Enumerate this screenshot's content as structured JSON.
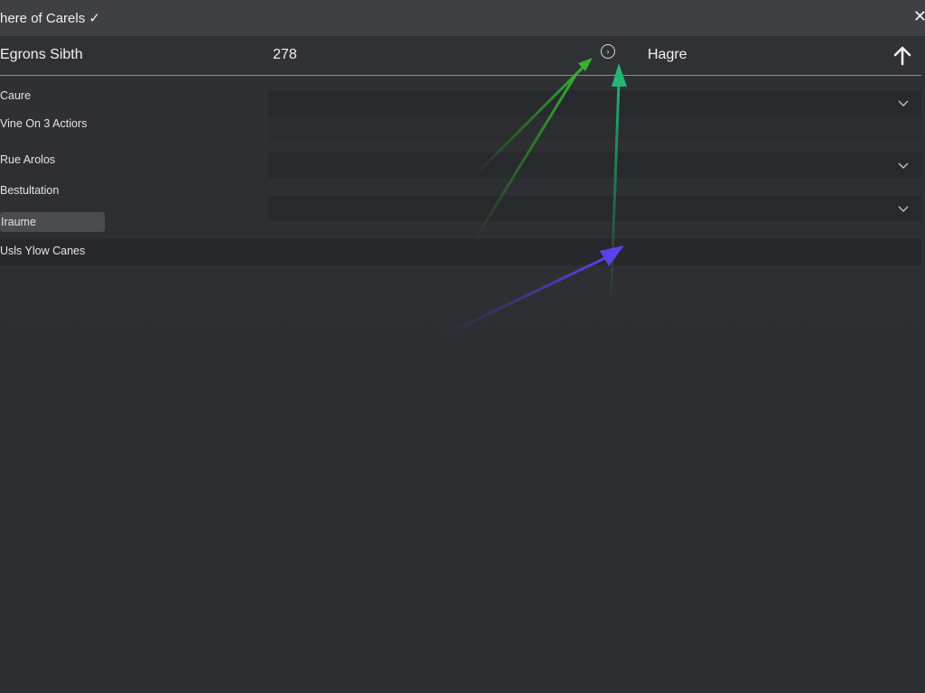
{
  "window": {
    "title": "here of Carels ✓",
    "close_glyph": "✕"
  },
  "header": {
    "name": "Egrons Sibth",
    "count": "278",
    "info_icon": "info-circle-icon",
    "label": "Hagre",
    "up_icon": "arrow-up-icon"
  },
  "sidebar": {
    "items": [
      {
        "label": "Caure"
      },
      {
        "label": "Vine On 3 Actiors"
      },
      {
        "label": "Rue Arolos"
      },
      {
        "label": "Bestultation"
      },
      {
        "label": "Iraume"
      },
      {
        "label": "Usls Ylow Canes"
      }
    ]
  },
  "dropdowns": [
    {
      "icon": "chevron-down-icon"
    },
    {
      "icon": "chevron-down-icon"
    },
    {
      "icon": "chevron-down-icon"
    }
  ],
  "colors": {
    "background": "#2c2e31",
    "titlebar": "#3e4043",
    "arrow_green": "#2fa52a",
    "arrow_teal": "#1fa36a",
    "arrow_purple": "#4a36d6"
  }
}
